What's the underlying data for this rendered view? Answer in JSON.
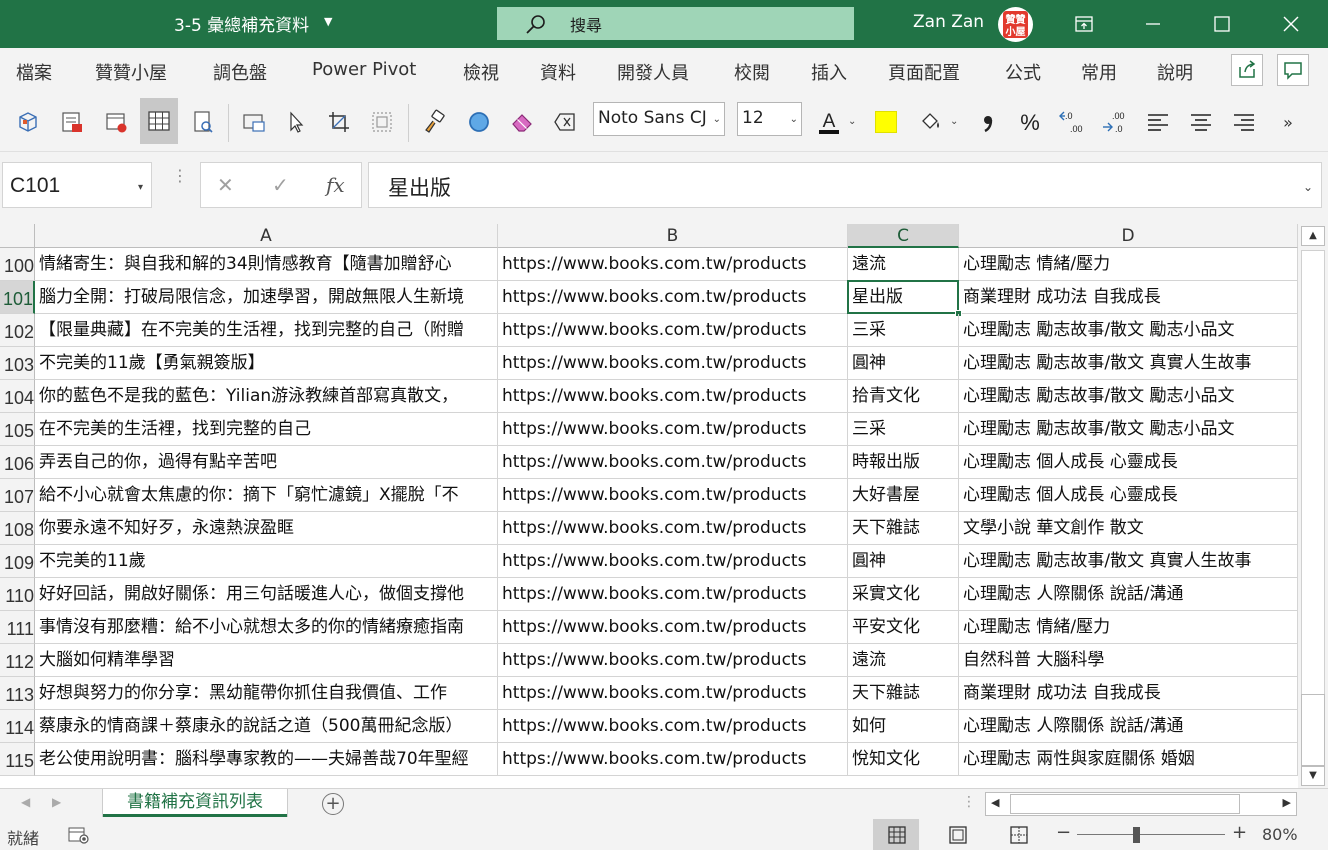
{
  "window": {
    "title": "3-5 彙總補充資料",
    "search_label": "搜尋",
    "user_name": "Zan Zan",
    "avatar_text": "贊贊小屋"
  },
  "menu": [
    "檔案",
    "贊贊小屋",
    "調色盤",
    "Power Pivot",
    "檢視",
    "資料",
    "開發人員",
    "校閱",
    "插入",
    "頁面配置",
    "公式",
    "常用",
    "說明"
  ],
  "toolbar": {
    "font_name": "Noto Sans CJ",
    "font_size": "12",
    "accent_color": "#217346",
    "highlight_color": "#ffff00"
  },
  "formula_bar": {
    "name_box": "C101",
    "fx_label": "fx",
    "cancel_label": "✕",
    "enter_label": "✓",
    "content": "星出版"
  },
  "grid": {
    "columns": [
      "A",
      "B",
      "C",
      "D"
    ],
    "selected_cell": "C101",
    "rows": [
      {
        "num": "100",
        "a": "情緒寄生：與自我和解的34則情感教育【隨書加贈舒心",
        "b": "https://www.books.com.tw/products",
        "c": "遠流",
        "d": "心理勵志 情緒/壓力"
      },
      {
        "num": "101",
        "a": "腦力全開：打破局限信念，加速學習，開啟無限人生新境",
        "b": "https://www.books.com.tw/products",
        "c": "星出版",
        "d": "商業理財 成功法 自我成長"
      },
      {
        "num": "102",
        "a": "【限量典藏】在不完美的生活裡，找到完整的自己（附贈",
        "b": "https://www.books.com.tw/products",
        "c": "三采",
        "d": "心理勵志 勵志故事/散文 勵志小品文"
      },
      {
        "num": "103",
        "a": "不完美的11歲【勇氣親簽版】",
        "b": "https://www.books.com.tw/products",
        "c": "圓神",
        "d": "心理勵志 勵志故事/散文 真實人生故事"
      },
      {
        "num": "104",
        "a": "你的藍色不是我的藍色：Yilian游泳教練首部寫真散文，",
        "b": "https://www.books.com.tw/products",
        "c": "拾青文化",
        "d": "心理勵志 勵志故事/散文 勵志小品文"
      },
      {
        "num": "105",
        "a": "在不完美的生活裡，找到完整的自己",
        "b": "https://www.books.com.tw/products",
        "c": "三采",
        "d": "心理勵志 勵志故事/散文 勵志小品文"
      },
      {
        "num": "106",
        "a": "弄丟自己的你，過得有點辛苦吧",
        "b": "https://www.books.com.tw/products",
        "c": "時報出版",
        "d": "心理勵志 個人成長 心靈成長"
      },
      {
        "num": "107",
        "a": "給不小心就會太焦慮的你：摘下「窮忙濾鏡」X擺脫「不",
        "b": "https://www.books.com.tw/products",
        "c": "大好書屋",
        "d": "心理勵志 個人成長 心靈成長"
      },
      {
        "num": "108",
        "a": "你要永遠不知好歹，永遠熱淚盈眶",
        "b": "https://www.books.com.tw/products",
        "c": "天下雜誌",
        "d": "文學小說 華文創作 散文"
      },
      {
        "num": "109",
        "a": "不完美的11歲",
        "b": "https://www.books.com.tw/products",
        "c": "圓神",
        "d": "心理勵志 勵志故事/散文 真實人生故事"
      },
      {
        "num": "110",
        "a": "好好回話，開啟好關係：用三句話暖進人心，做個支撐他",
        "b": "https://www.books.com.tw/products",
        "c": "采實文化",
        "d": "心理勵志 人際關係 說話/溝通"
      },
      {
        "num": "111",
        "a": "事情沒有那麼糟：給不小心就想太多的你的情緒療癒指南",
        "b": "https://www.books.com.tw/products",
        "c": "平安文化",
        "d": "心理勵志 情緒/壓力"
      },
      {
        "num": "112",
        "a": "大腦如何精準學習",
        "b": "https://www.books.com.tw/products",
        "c": "遠流",
        "d": "自然科普 大腦科學"
      },
      {
        "num": "113",
        "a": "好想與努力的你分享：黑幼龍帶你抓住自我價值、工作",
        "b": "https://www.books.com.tw/products",
        "c": "天下雜誌",
        "d": "商業理財 成功法 自我成長"
      },
      {
        "num": "114",
        "a": "蔡康永的情商課＋蔡康永的說話之道（500萬冊紀念版）",
        "b": "https://www.books.com.tw/products",
        "c": "如何",
        "d": "心理勵志 人際關係 說話/溝通"
      },
      {
        "num": "115",
        "a": "老公使用說明書：腦科學專家教的——夫婦善哉70年聖經",
        "b": "https://www.books.com.tw/products",
        "c": "悅知文化",
        "d": "心理勵志 兩性與家庭關係 婚姻"
      }
    ]
  },
  "sheets": {
    "active": "書籍補充資訊列表",
    "add_label": "+"
  },
  "status": {
    "ready": "就緒",
    "zoom": "80%",
    "zoom_level_percent": 80
  }
}
